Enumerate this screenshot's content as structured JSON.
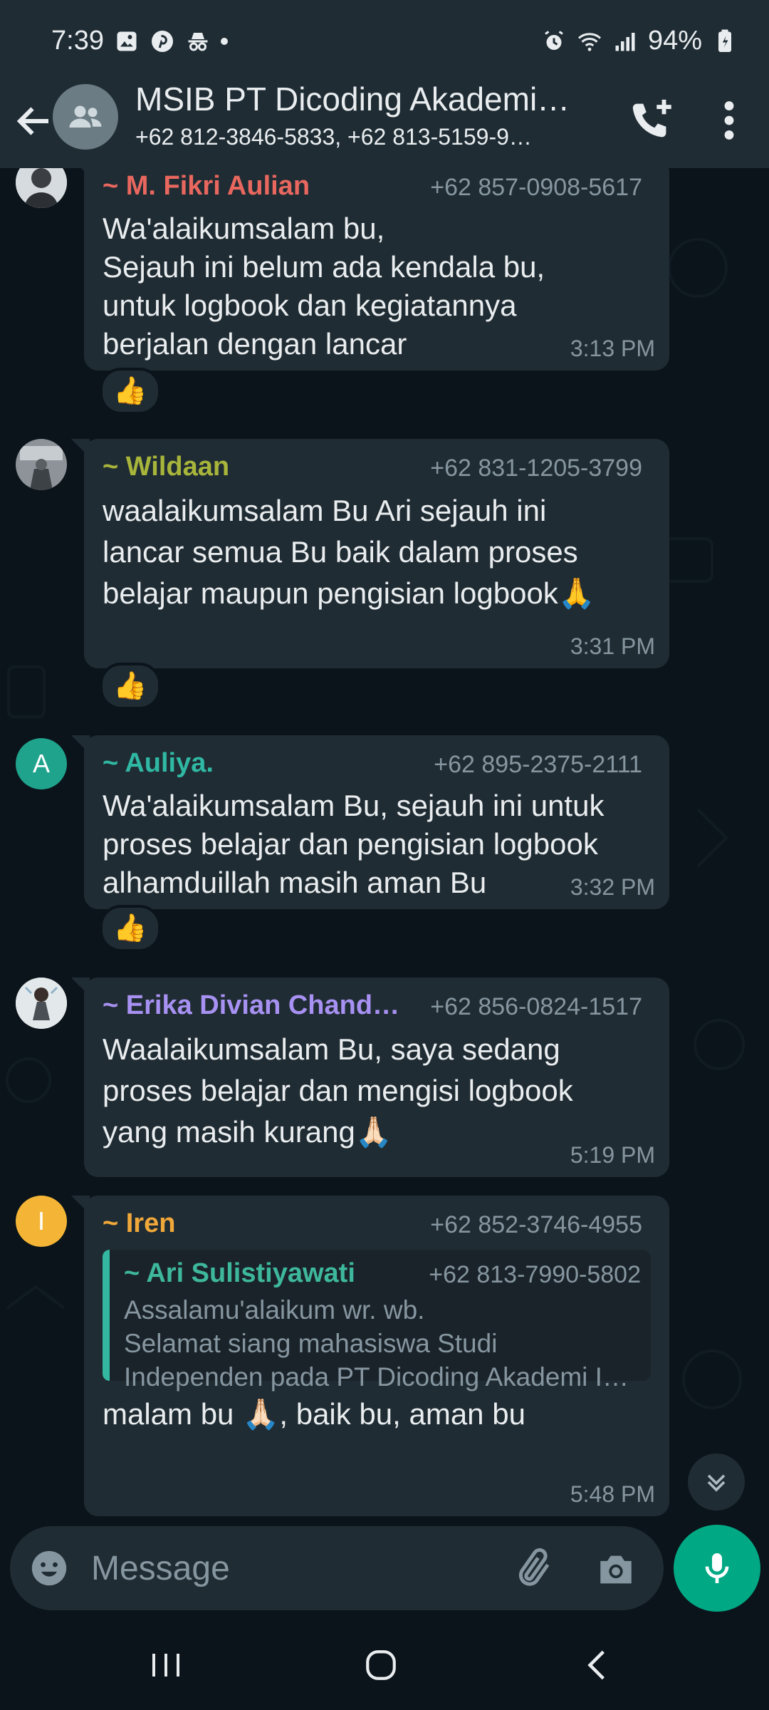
{
  "status_bar": {
    "time": "7:39",
    "battery": "94%"
  },
  "header": {
    "title": "MSIB PT Dicoding Akademi…",
    "subtitle": "+62 812-3846-5833, +62 813-5159-9…"
  },
  "messages": [
    {
      "sender": "~ M. Fikri Aulian",
      "sender_color": "#e8675f",
      "phone": "+62 857-0908-5617",
      "text": "Wa'alaikumsalam bu,\nSejauh ini belum ada kendala bu,\nuntuk logbook dan kegiatannya\nberjalan dengan lancar",
      "time": "3:13 PM",
      "reaction": "👍"
    },
    {
      "sender": "~ Wildaan",
      "sender_color": "#a8b53b",
      "phone": "+62 831-1205-3799",
      "text": "waalaikumsalam Bu Ari sejauh ini\nlancar semua Bu baik dalam proses\nbelajar maupun pengisian logbook🙏",
      "time": "3:31 PM",
      "reaction": "👍"
    },
    {
      "sender": "~ Auliya.",
      "sender_color": "#2fb8a3",
      "avatar_letter": "A",
      "avatar_color": "#1fa38c",
      "phone": "+62 895-2375-2111",
      "text": "Wa'alaikumsalam Bu, sejauh ini untuk\nproses belajar dan pengisian logbook\nalhamduillah masih aman Bu",
      "time": "3:32 PM",
      "reaction": "👍"
    },
    {
      "sender": "~ Erika Divian Chand…",
      "sender_color": "#a791f2",
      "phone": "+62 856-0824-1517",
      "text": "Waalaikumsalam Bu, saya sedang\nproses belajar dan mengisi logbook\nyang masih kurang🙏🏻",
      "time": "5:19 PM"
    },
    {
      "sender": "~ Iren",
      "sender_color": "#f1a83a",
      "avatar_letter": "I",
      "avatar_color": "#f4b536",
      "phone": "+62 852-3746-4955",
      "quote": {
        "sender": "~ Ari Sulistiyawati",
        "phone": "+62 813-7990-5802",
        "text": "Assalamu'alaikum wr. wb.\nSelamat siang mahasiswa Studi\nIndependen pada PT Dicoding Akademi I…"
      },
      "text": "malam bu 🙏🏻, baik bu, aman bu",
      "time": "5:48 PM"
    }
  ],
  "composer": {
    "placeholder": "Message"
  },
  "icons": {
    "back": "back-arrow-icon",
    "call": "add-call-icon",
    "menu": "more-vert-icon",
    "emoji": "emoji-icon",
    "attach": "paperclip-icon",
    "camera": "camera-icon",
    "mic": "mic-icon",
    "scroll": "double-chevron-down-icon"
  },
  "colors": {
    "accent": "#00a884",
    "header_bg": "#1f2c34",
    "chat_bg": "#0b141a",
    "bubble_bg": "#202c33"
  }
}
